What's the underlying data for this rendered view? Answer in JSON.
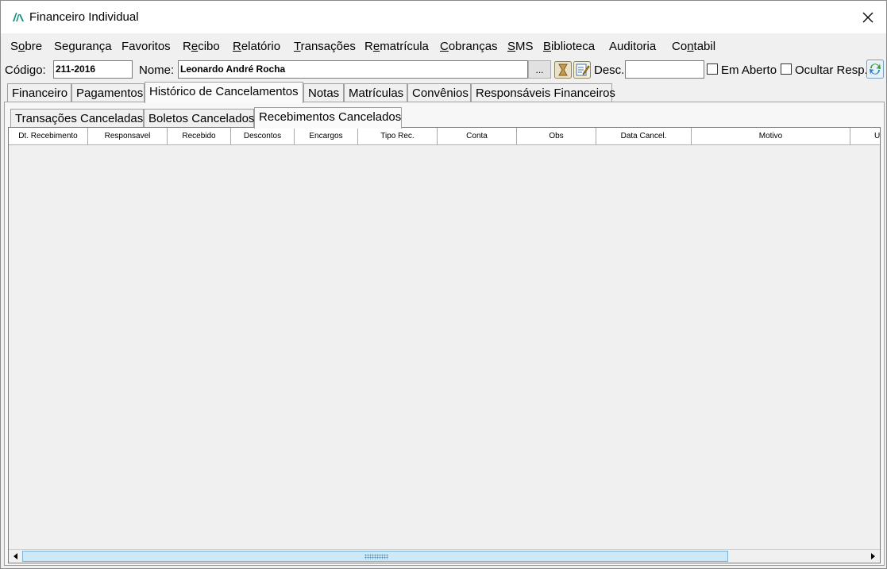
{
  "window": {
    "title": "Financeiro Individual"
  },
  "menu": [
    {
      "pre": "S",
      "ul": "o",
      "post": "bre"
    },
    {
      "pre": "",
      "ul": "",
      "post": "Segurança"
    },
    {
      "pre": "",
      "ul": "",
      "post": "Favoritos"
    },
    {
      "pre": "R",
      "ul": "e",
      "post": "cibo"
    },
    {
      "pre": "",
      "ul": "R",
      "post": "elatório"
    },
    {
      "pre": "",
      "ul": "T",
      "post": "ransações"
    },
    {
      "pre": "R",
      "ul": "e",
      "post": "matrícula"
    },
    {
      "pre": "",
      "ul": "C",
      "post": "obranças"
    },
    {
      "pre": "",
      "ul": "S",
      "post": "MS"
    },
    {
      "pre": "",
      "ul": "B",
      "post": "iblioteca"
    },
    {
      "pre": "",
      "ul": "",
      "post": "Auditoria"
    },
    {
      "pre": "Co",
      "ul": "n",
      "post": "tabil"
    }
  ],
  "toolbar": {
    "codigo_label": "Código:",
    "codigo_value": "211-2016",
    "nome_label": "Nome:",
    "nome_value": "Leonardo André Rocha",
    "dots_label": "...",
    "desc_label": "Desc.:",
    "desc_value": "",
    "em_aberto_label": "Em Aberto",
    "ocultar_label": "Ocultar Resp."
  },
  "tabs": [
    {
      "label": "Financeiro",
      "active": false
    },
    {
      "label": "Pagamentos",
      "active": false
    },
    {
      "label": "Histórico de Cancelamentos",
      "active": true
    },
    {
      "label": "Notas",
      "active": false
    },
    {
      "label": "Matrículas",
      "active": false
    },
    {
      "label": "Convênios",
      "active": false
    },
    {
      "label": "Responsáveis Financeiros",
      "active": false
    }
  ],
  "subtabs": [
    {
      "label": "Transações Canceladas",
      "active": false
    },
    {
      "label": "Boletos Cancelados",
      "active": false
    },
    {
      "label": "Recebimentos Cancelados",
      "active": true
    }
  ],
  "grid": {
    "columns": [
      "Dt. Recebimento",
      "Responsavel",
      "Recebido",
      "Descontos",
      "Encargos",
      "Tipo Rec.",
      "Conta",
      "Obs",
      "Data Cancel.",
      "Motivo",
      "U"
    ]
  },
  "colors": {
    "accent": "#2e9e8f",
    "scroll_thumb": "#cde8f7"
  }
}
